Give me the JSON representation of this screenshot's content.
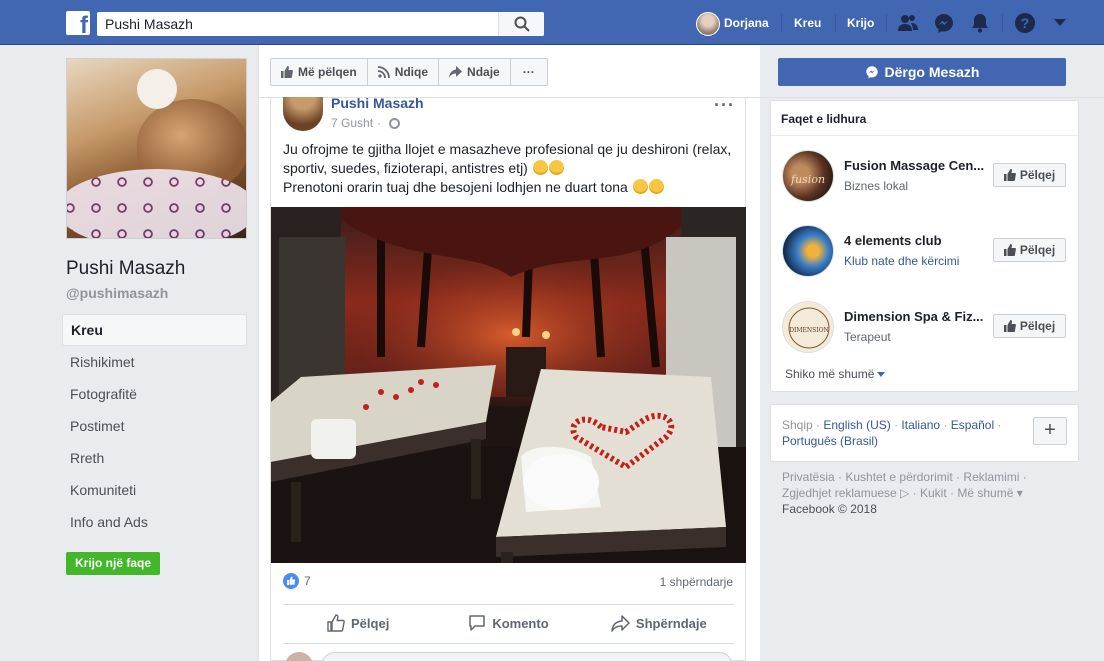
{
  "topbar": {
    "search_value": "Pushi Masazh",
    "user_name": "Dorjana",
    "home": "Kreu",
    "create": "Krijo",
    "icons": [
      "friends-icon",
      "messenger-icon",
      "notifications-icon",
      "help-icon",
      "caret-down-icon"
    ]
  },
  "page": {
    "name": "Pushi Masazh",
    "handle": "@pushimasazh"
  },
  "left_nav": [
    {
      "label": "Kreu",
      "active": true
    },
    {
      "label": "Rishikimet"
    },
    {
      "label": "Fotografitë"
    },
    {
      "label": "Postimet"
    },
    {
      "label": "Rreth"
    },
    {
      "label": "Komuniteti"
    },
    {
      "label": "Info and Ads"
    }
  ],
  "create_page": "Krijo një faqe",
  "action_bar": {
    "like": "Më pëlqen",
    "follow": "Ndiqe",
    "share": "Ndaje",
    "more": "···"
  },
  "message_button": "Dërgo Mesazh",
  "post": {
    "author": "Pushi Masazh",
    "date": "7 Gusht",
    "text_line1": "Ju ofrojme te gjitha llojet e masazheve profesional qe ju deshironi (relax, sportiv, suedes, fizioterapi, antistres etj)",
    "text_line2": "Prenotoni orarin tuaj dhe besojeni lodhjen ne duart tona",
    "likes": "7",
    "shares": "1 shpërndarje",
    "like_label": "Pëlqej",
    "comment_label": "Komento",
    "share_label": "Shpërndaje"
  },
  "liked_pages": {
    "title": "Faqet e lidhura",
    "items": [
      {
        "name": "Fusion Massage Cen...",
        "category": "Biznes lokal",
        "button": "Pëlqej"
      },
      {
        "name": "4 elements club",
        "category": "Klub nate dhe kërcimi",
        "button": "Pëlqej"
      },
      {
        "name": "Dimension Spa & Fiz...",
        "category": "Terapeut",
        "button": "Pëlqej"
      }
    ],
    "see_more": "Shiko më shumë"
  },
  "languages": {
    "current": "Shqip",
    "links": [
      "English (US)",
      "Italiano",
      "Español",
      "Português (Brasil)"
    ]
  },
  "footer": {
    "links": [
      "Privatësia",
      "Kushtet e përdorimit",
      "Reklamimi",
      "Zgjedhjet reklamuese",
      "Kukit",
      "Më shumë"
    ],
    "copyright": "Facebook © 2018"
  },
  "colors": {
    "brand": "#4267b2",
    "link": "#365899",
    "green": "#42b72a"
  }
}
